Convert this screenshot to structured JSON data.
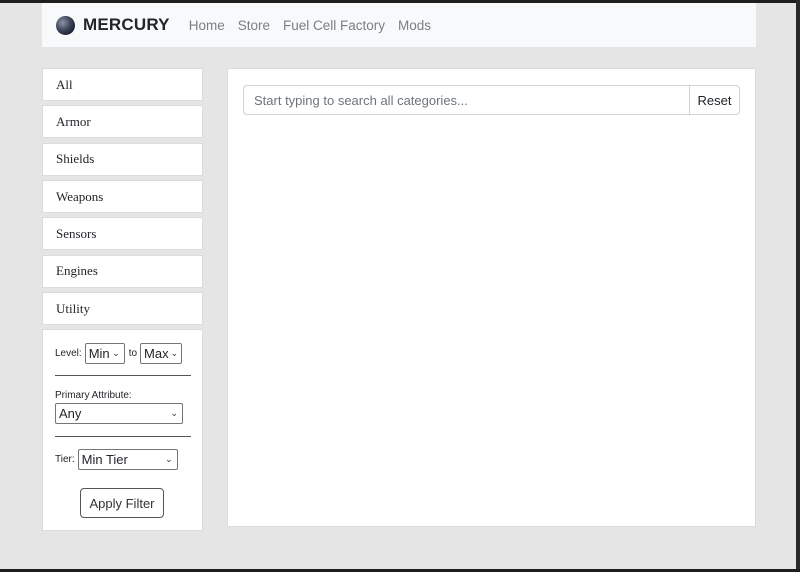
{
  "navbar": {
    "brand": "MERCURY",
    "links": [
      "Home",
      "Store",
      "Fuel Cell Factory",
      "Mods"
    ]
  },
  "sidebar": {
    "categories": [
      "All",
      "Armor",
      "Shields",
      "Weapons",
      "Sensors",
      "Engines",
      "Utility"
    ]
  },
  "filters": {
    "level_label": "Level:",
    "level_min": "Min",
    "level_to": "to",
    "level_max": "Max",
    "primary_attribute_label": "Primary Attribute:",
    "primary_attribute_value": "Any",
    "tier_label": "Tier:",
    "tier_value": "Min Tier",
    "apply_label": "Apply Filter"
  },
  "search": {
    "placeholder": "Start typing to search all categories...",
    "value": "",
    "reset_label": "Reset"
  },
  "colors": {
    "background": "#e5e5e5",
    "navbar": "#f8f9fa",
    "panel": "#ffffff",
    "border": "#dcdcdc"
  }
}
